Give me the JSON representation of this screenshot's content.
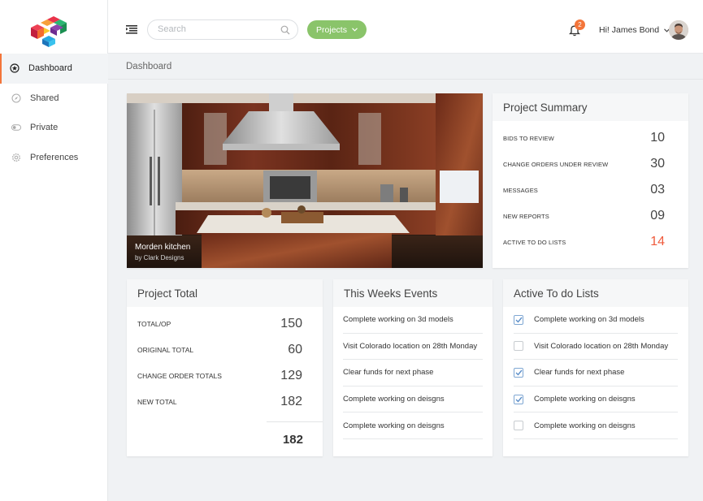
{
  "app": {
    "logo_icon": "cube-blocks-logo",
    "accent": "#f3753a",
    "green": "#8ac46a",
    "red": "#ef5a3c"
  },
  "sidebar": {
    "items": [
      {
        "label": "Dashboard",
        "icon": "star-circle-icon",
        "active": true
      },
      {
        "label": "Shared",
        "icon": "compass-icon",
        "active": false
      },
      {
        "label": "Private",
        "icon": "toggle-icon",
        "active": false
      },
      {
        "label": "Preferences",
        "icon": "gear-icon",
        "active": false
      }
    ]
  },
  "header": {
    "search_placeholder": "Search",
    "projects_label": "Projects",
    "notifications_count": "2",
    "user_greeting": "Hi! James Bond"
  },
  "breadcrumb": {
    "current": "Dashboard"
  },
  "photo": {
    "title": "Morden kitchen",
    "credit": "by Clark Designs"
  },
  "summary": {
    "title": "Project Summary",
    "rows": [
      {
        "label": "BIDS TO REVIEW",
        "value": "10"
      },
      {
        "label": "CHANGE ORDERS UNDER REVIEW",
        "value": "30"
      },
      {
        "label": "MESSAGES",
        "value": "03"
      },
      {
        "label": "NEW REPORTS",
        "value": "09"
      },
      {
        "label": "ACTIVE TO DO LISTS",
        "value": "14"
      }
    ]
  },
  "project_total": {
    "title": "Project Total",
    "rows": [
      {
        "label": "TOTAL/OP",
        "value": "150"
      },
      {
        "label": "ORIGINAL TOTAL",
        "value": "60"
      },
      {
        "label": "CHANGE ORDER TOTALS",
        "value": "129"
      },
      {
        "label": "NEW TOTAL",
        "value": "182"
      }
    ],
    "grand_total": "182"
  },
  "events": {
    "title": "This Weeks Events",
    "items": [
      "Complete working on 3d models",
      "Visit Colorado location on 28th Monday",
      "Clear funds for next phase",
      "Complete working on deisgns",
      "Complete working on deisgns"
    ]
  },
  "todos": {
    "title": "Active To do Lists",
    "items": [
      {
        "label": "Complete working on 3d models",
        "checked": true
      },
      {
        "label": "Visit Colorado location on 28th Monday",
        "checked": false
      },
      {
        "label": "Clear funds for next phase",
        "checked": true
      },
      {
        "label": "Complete working on deisgns",
        "checked": true
      },
      {
        "label": "Complete working on deisgns",
        "checked": false
      }
    ]
  }
}
